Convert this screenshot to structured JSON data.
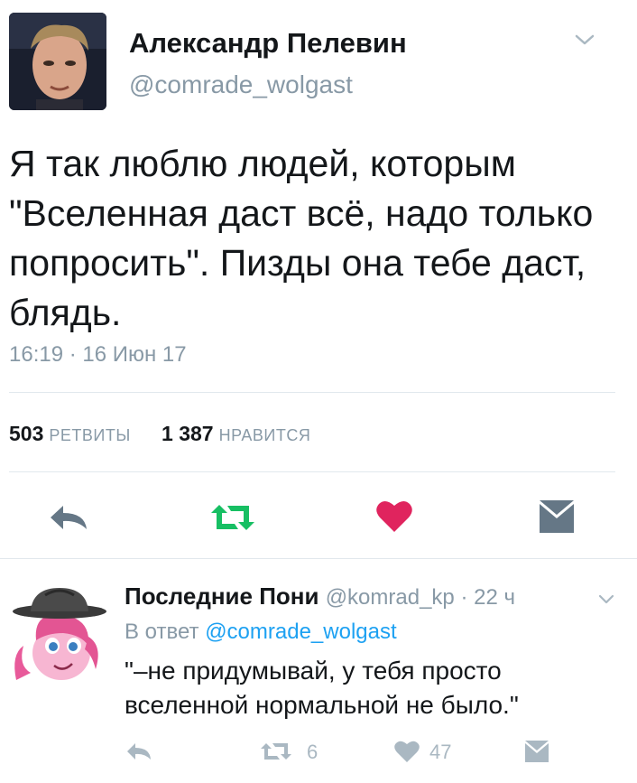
{
  "tweet": {
    "author_name": "Александр Пелевин",
    "author_handle": "@comrade_wolgast",
    "text": "Я так люблю людей, которым \"Вселенная даст всё, надо только попросить\". Пизды она тебе даст, блядь.",
    "timestamp": "16:19 · 16 Июн 17",
    "retweets_count": "503",
    "retweets_label": "РЕТВИТЫ",
    "likes_count": "1 387",
    "likes_label": "НРАВИТСЯ",
    "actions": [
      "reply-icon",
      "retweet-icon",
      "like-icon",
      "message-icon"
    ],
    "colors": {
      "retweet": "#17bf63",
      "like": "#e0245e",
      "icon": "#657786"
    }
  },
  "reply": {
    "author_name": "Последние  Пони",
    "author_handle": "@komrad_kp",
    "time": " · 22 ч",
    "in_reply_to_prefix": "В ответ ",
    "in_reply_to_mention": "@comrade_wolgast",
    "text": "\"–не придумывай,  у тебя просто вселенной нормальной не было.\"",
    "retweets_count": "6",
    "likes_count": "47"
  }
}
